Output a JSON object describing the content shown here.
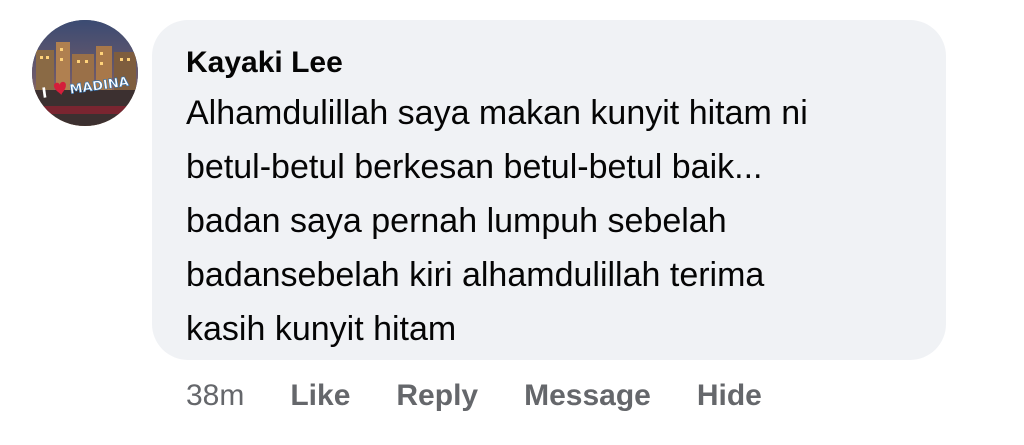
{
  "comment": {
    "author": "Kayaki Lee",
    "avatar_text": "I ❤ MADINA",
    "body_lines": [
      "Alhamdulillah saya makan kunyit hitam ni",
      "betul-betul berkesan betul-betul baik...",
      "badan saya pernah lumpuh sebelah",
      "badansebelah kiri alhamdulillah terima",
      "kasih kunyit hitam"
    ],
    "timestamp": "38m",
    "actions": {
      "like": "Like",
      "reply": "Reply",
      "message": "Message",
      "hide": "Hide"
    }
  },
  "colors": {
    "bubble_background": "#f0f2f5",
    "text_primary": "#050505",
    "text_secondary": "#65676b"
  }
}
